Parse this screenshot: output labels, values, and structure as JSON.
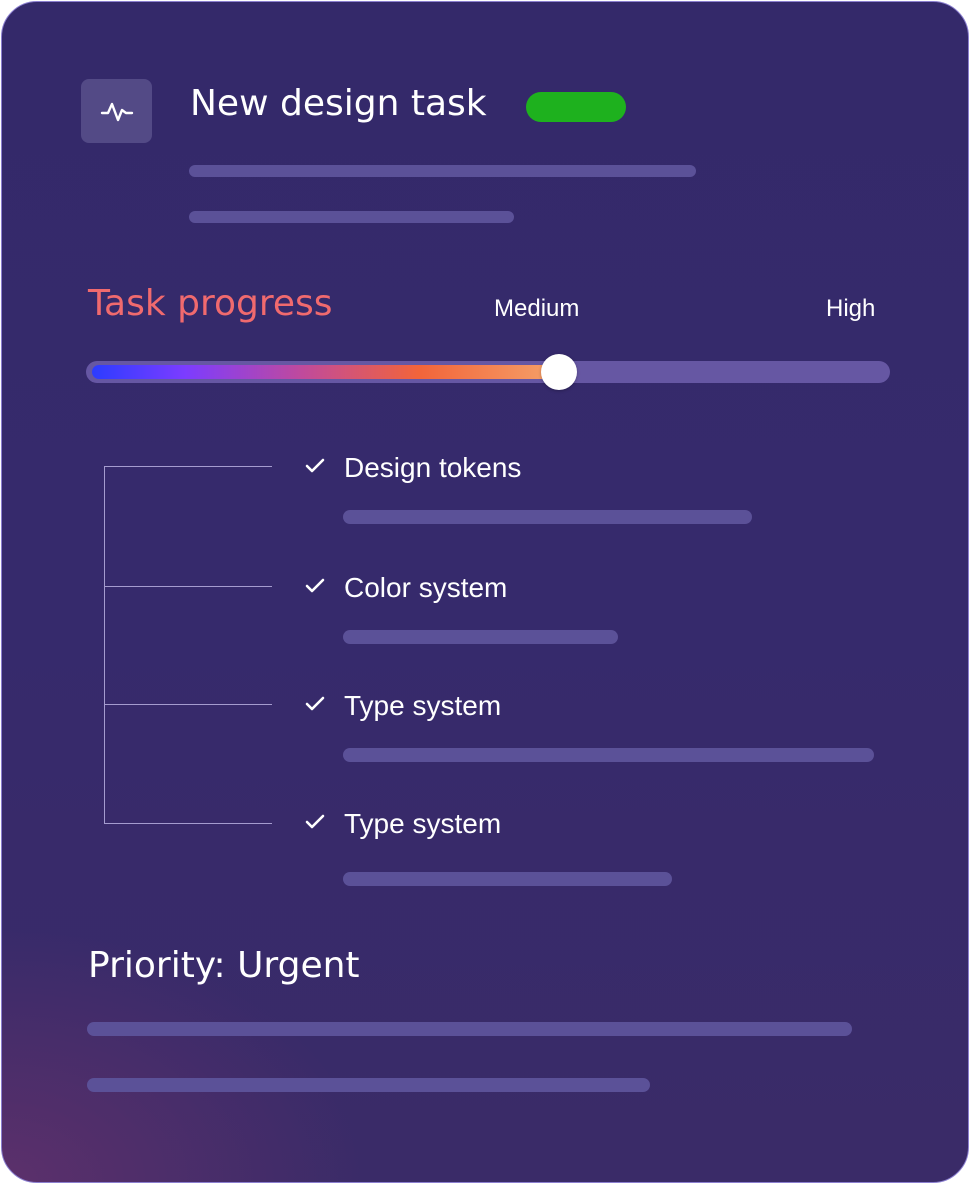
{
  "task": {
    "title": "New design task",
    "status_color": "#1eb11e"
  },
  "progress": {
    "label": "Task progress",
    "levels": [
      "Medium",
      "High"
    ],
    "value_fraction": 0.59
  },
  "checklist": [
    {
      "label": "Design tokens",
      "checked": true
    },
    {
      "label": "Color system",
      "checked": true
    },
    {
      "label": "Type system",
      "checked": true
    },
    {
      "label": "Type system",
      "checked": true
    }
  ],
  "priority": {
    "text": "Priority: Urgent"
  },
  "colors": {
    "accent": "#f06a6e",
    "background": "#34296a",
    "status": "#1eb11e"
  },
  "icons": {
    "header": "activity-pulse-icon",
    "check": "checkmark-icon"
  }
}
